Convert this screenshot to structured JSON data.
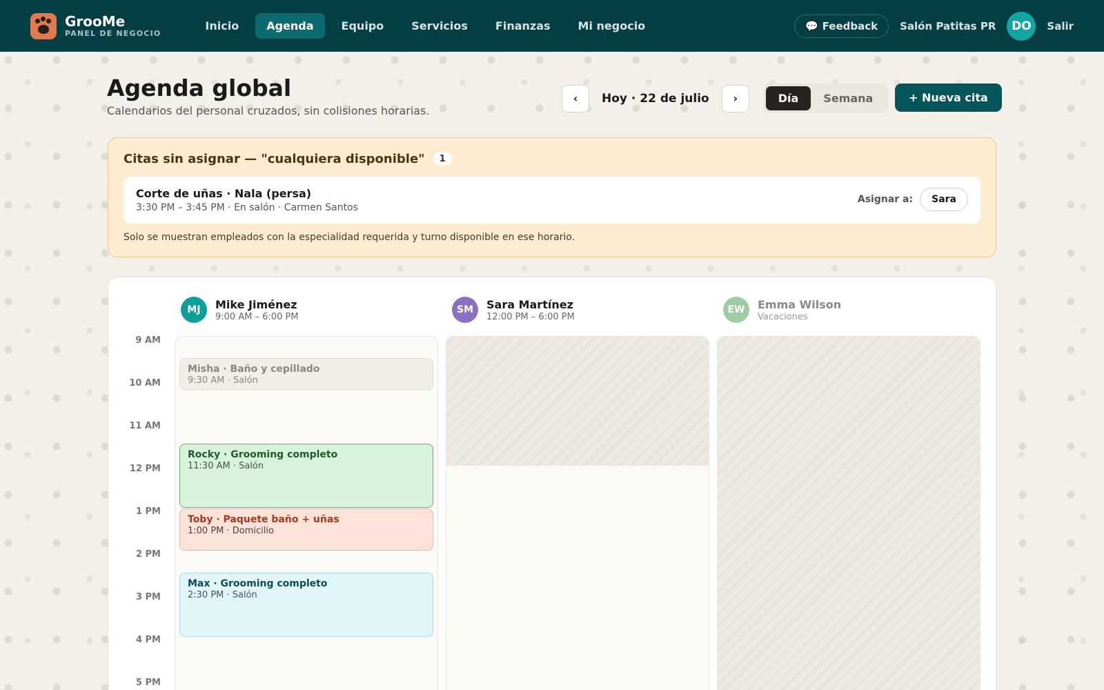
{
  "app": {
    "name": "GrooMe",
    "subtitle": "PANEL DE NEGOCIO"
  },
  "nav": [
    {
      "label": "Inicio",
      "active": false
    },
    {
      "label": "Agenda",
      "active": true
    },
    {
      "label": "Equipo",
      "active": false
    },
    {
      "label": "Servicios",
      "active": false
    },
    {
      "label": "Finanzas",
      "active": false
    },
    {
      "label": "Mi negocio",
      "active": false
    }
  ],
  "topbar": {
    "feedback": "Feedback",
    "salon": "Salón Patitas PR",
    "avatar": "DO",
    "logout": "Salir"
  },
  "header": {
    "title": "Agenda global",
    "subtitle": "Calendarios del personal cruzados, sin colisiones horarias.",
    "date_label": "Hoy · 22 de julio",
    "prev": "‹",
    "next": "›",
    "view_day": "Día",
    "view_week": "Semana",
    "new_appointment": "+ Nueva cita"
  },
  "unassigned": {
    "title": "Citas sin asignar — \"cualquiera disponible\"",
    "count": "1",
    "item": {
      "title": "Corte de uñas · Nala (persa)",
      "details": "3:30 PM – 3:45 PM · En salón · Carmen Santos",
      "assign_label": "Asignar a:",
      "assign_option": "Sara"
    },
    "note": "Solo se muestran empleados con la especialidad requerida y turno disponible en ese horario."
  },
  "times": [
    "9 AM",
    "10 AM",
    "11 AM",
    "12 PM",
    "1 PM",
    "2 PM",
    "3 PM",
    "4 PM",
    "5 PM"
  ],
  "staff": [
    {
      "initials": "MJ",
      "name": "Mike Jiménez",
      "hours": "9:00 AM – 6:00 PM",
      "color": "#0f9e9a"
    },
    {
      "initials": "SM",
      "name": "Sara Martínez",
      "hours": "12:00 PM – 6:00 PM",
      "color": "#8b6fc0"
    },
    {
      "initials": "EW",
      "name": "Emma Wilson",
      "hours": "Vacaciones",
      "color": "#9fcca6"
    }
  ],
  "appointments": [
    {
      "title": "Misha · Baño y cepillado",
      "details": "9:30 AM · Salón",
      "status": "past"
    },
    {
      "title": "Rocky · Grooming completo",
      "details": "11:30 AM · Salón",
      "status": "green"
    },
    {
      "title": "Toby · Paquete baño + uñas",
      "details": "1:00 PM · Domicilio",
      "status": "red"
    },
    {
      "title": "Max · Grooming completo",
      "details": "2:30 PM · Salón",
      "status": "blue"
    }
  ],
  "colors": {
    "topbar": "#053f44",
    "accent": "#06555a",
    "warning_bg": "#fcecd2"
  }
}
